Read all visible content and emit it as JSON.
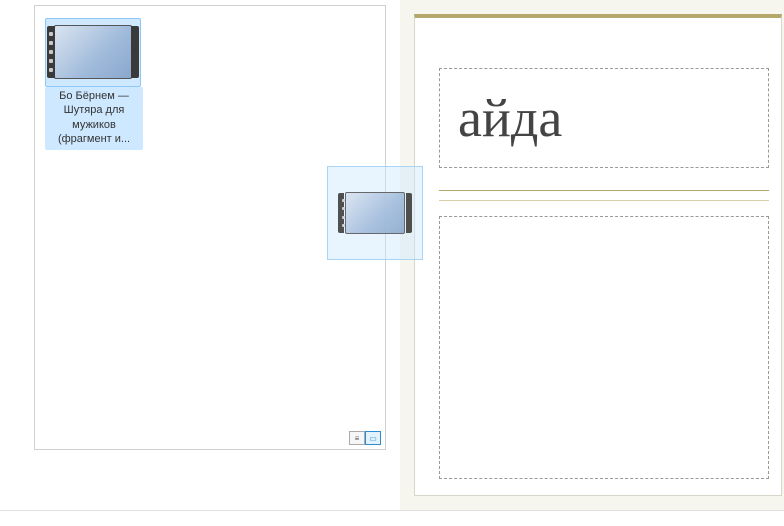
{
  "file": {
    "name": "Бо Бёрнем — Шутяра для мужиков (фрагмент и...",
    "icon_name": "video-file-icon"
  },
  "drag_ghost": {
    "icon_name": "video-file-icon"
  },
  "slide": {
    "title_text": "айда"
  },
  "view_switch": {
    "list_icon": "list-view-icon",
    "thumb_icon": "thumbnail-view-icon"
  }
}
